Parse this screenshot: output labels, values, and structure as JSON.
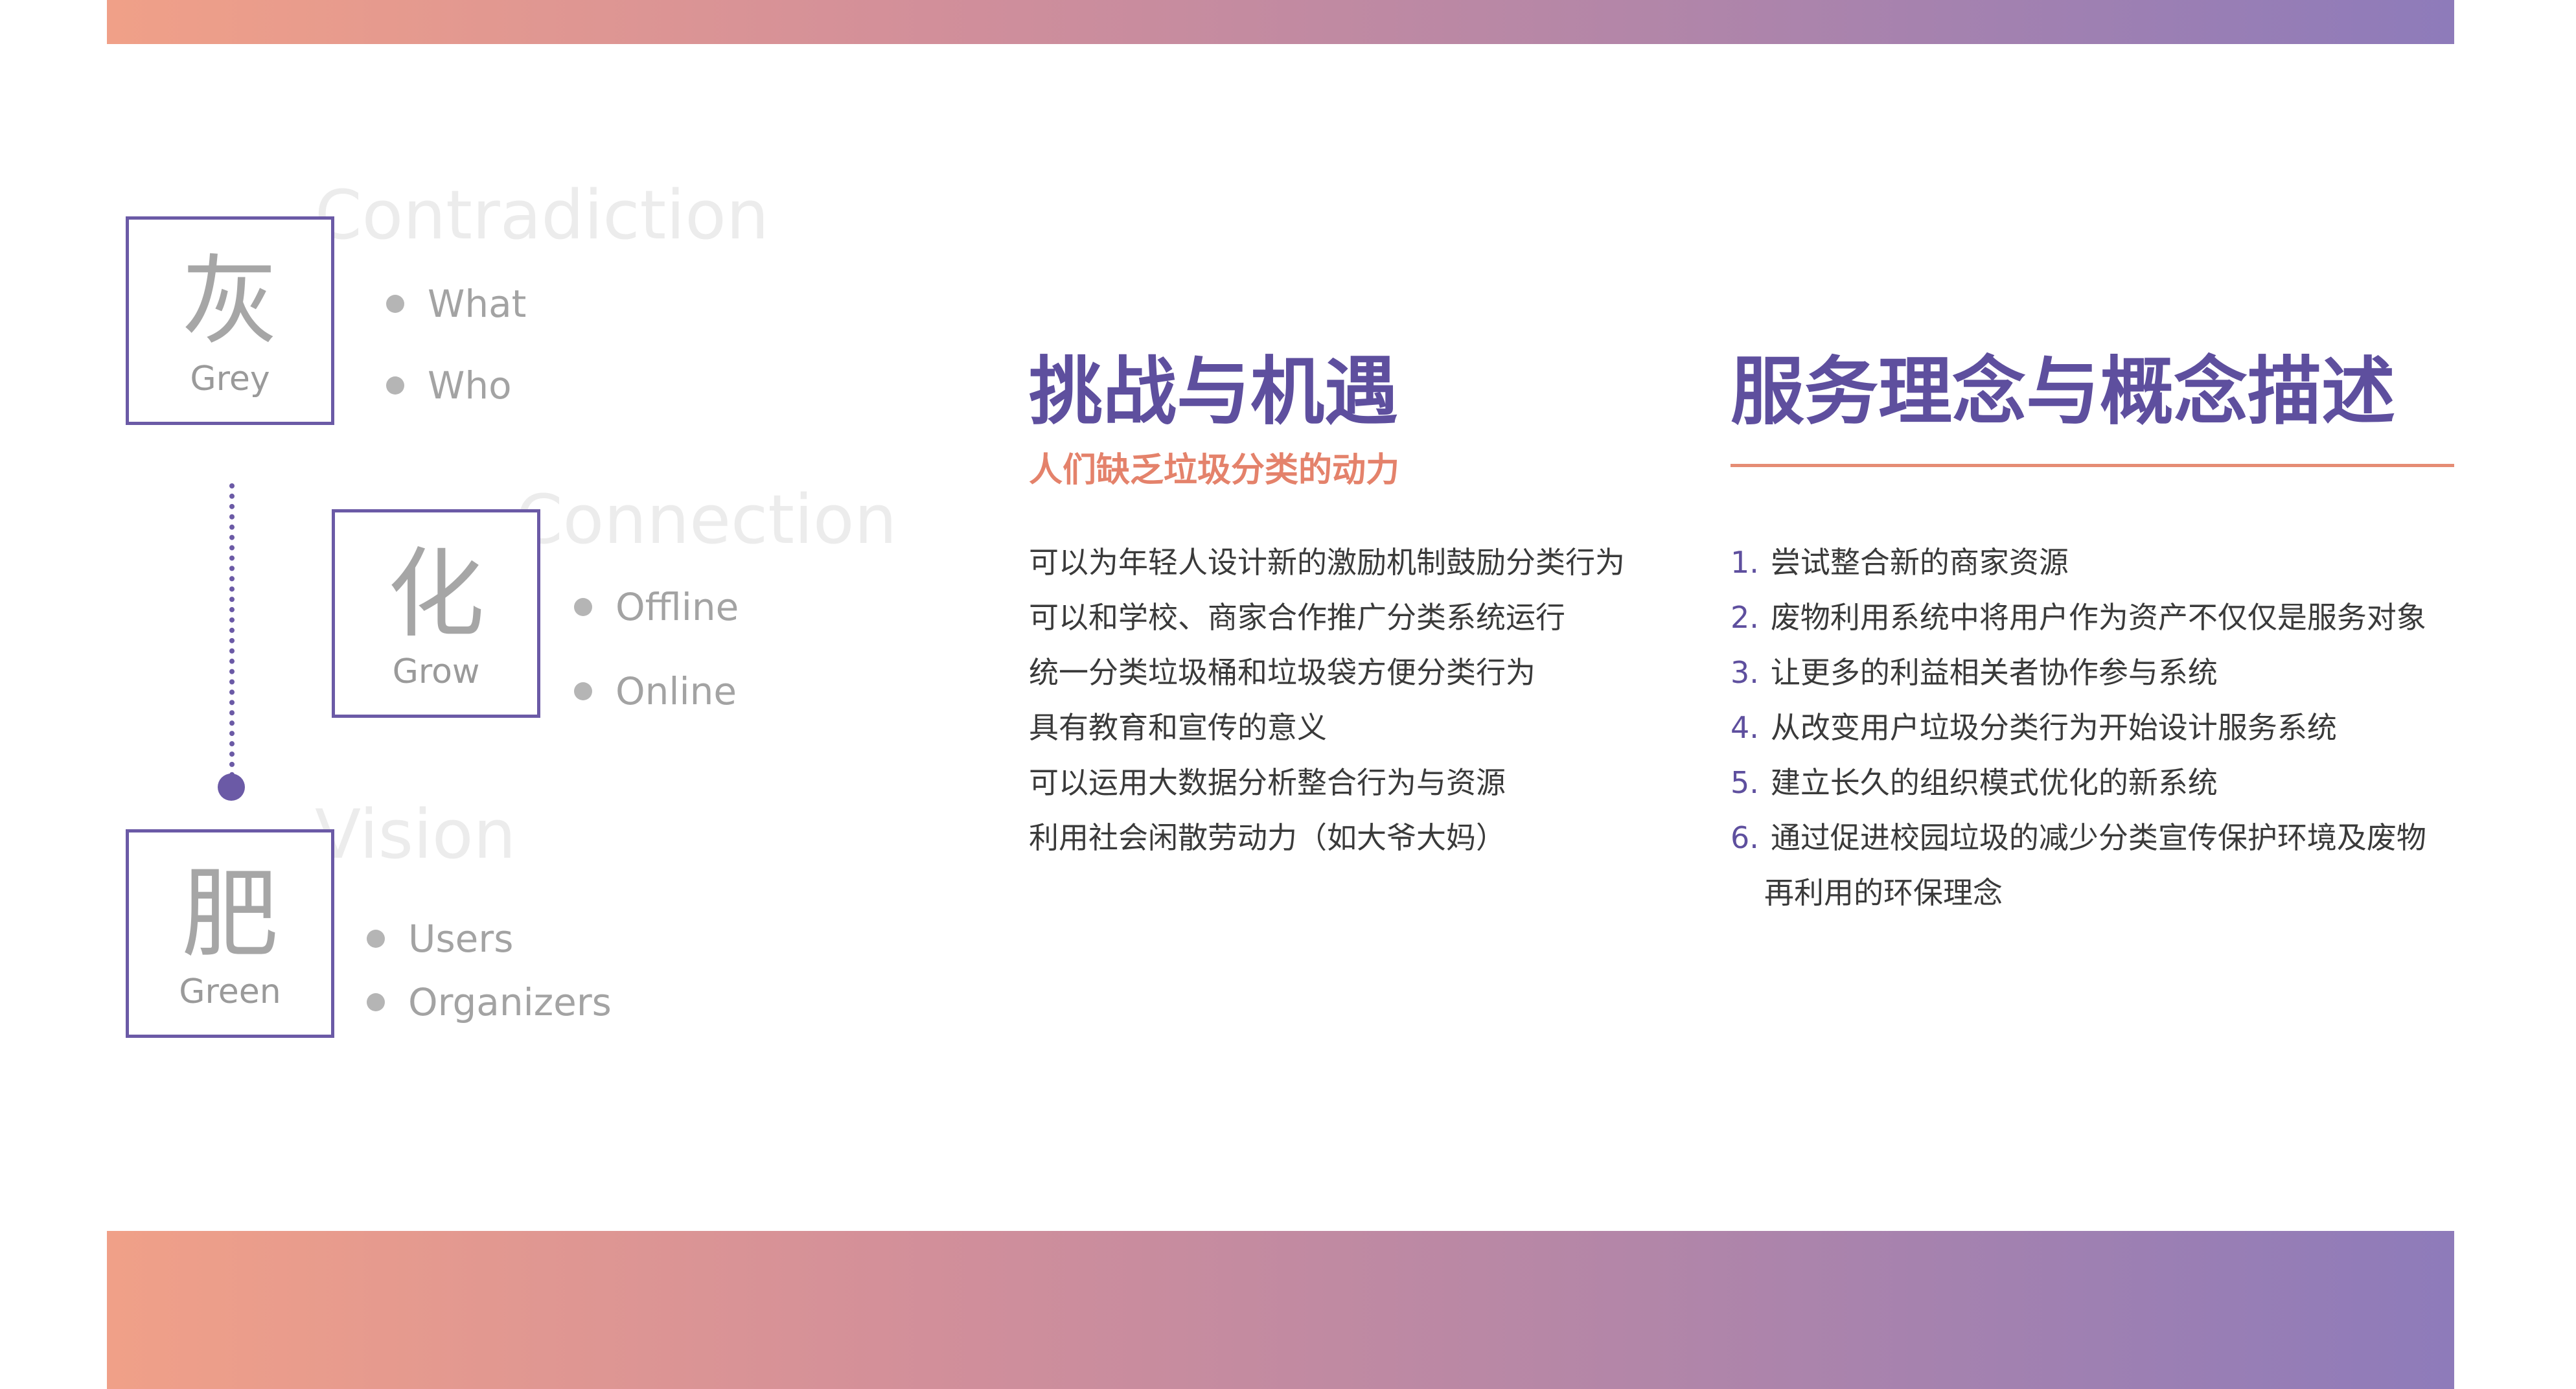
{
  "left": {
    "sections": [
      {
        "ghost": "Contradiction",
        "char": "灰",
        "label": "Grey",
        "bullets": [
          "What",
          "Who"
        ]
      },
      {
        "ghost": "Connection",
        "char": "化",
        "label": "Grow",
        "bullets": [
          "Offline",
          "Online"
        ]
      },
      {
        "ghost": "Vision",
        "char": "肥",
        "label": "Green",
        "bullets": [
          "Users",
          "Organizers"
        ]
      }
    ]
  },
  "challenges": {
    "title": "挑战与机遇",
    "subtitle": "人们缺乏垃圾分类的动力",
    "items": [
      "可以为年轻人设计新的激励机制鼓励分类行为",
      "可以和学校、商家合作推广分类系统运行",
      "统一分类垃圾桶和垃圾袋方便分类行为",
      "具有教育和宣传的意义",
      "可以运用大数据分析整合行为与资源",
      "利用社会闲散劳动力（如大爷大妈）"
    ]
  },
  "concept": {
    "title": "服务理念与概念描述",
    "items": [
      {
        "num": "1.",
        "text": "尝试整合新的商家资源"
      },
      {
        "num": "2.",
        "text": "废物利用系统中将用户作为资产不仅仅是服务对象"
      },
      {
        "num": "3.",
        "text": "让更多的利益相关者协作参与系统"
      },
      {
        "num": "4.",
        "text": "从改变用户垃圾分类行为开始设计服务系统"
      },
      {
        "num": "5.",
        "text": "建立长久的组织模式优化的新系统"
      },
      {
        "num": "6.",
        "text": "通过促进校园垃圾的减少分类宣传保护环境及废物"
      }
    ],
    "continuation": "再利用的环保理念"
  },
  "colors": {
    "accent_purple": "#6b5aa6",
    "accent_orange": "#e4826b",
    "gradient_start": "#f0a088",
    "gradient_end": "#8e7bba"
  }
}
